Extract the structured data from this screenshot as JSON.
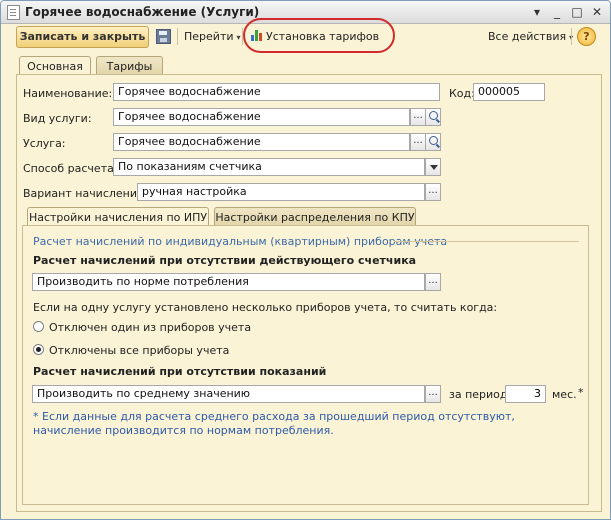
{
  "window": {
    "title": "Горячее водоснабжение (Услуги)",
    "controls": {
      "menu": "▾",
      "minimize": "_",
      "maximize": "□",
      "close": "✕"
    }
  },
  "toolbar": {
    "save_close_label": "Записать и закрыть",
    "goto_label": "Перейти",
    "tariffs_label": "Установка тарифов",
    "all_actions_label": "Все действия",
    "help_label": "?"
  },
  "tabs": [
    {
      "label": "Основная",
      "active": true
    },
    {
      "label": "Тарифы",
      "active": false
    }
  ],
  "form": {
    "name_label": "Наименование:",
    "name_value": "Горячее водоснабжение",
    "code_label": "Код:",
    "code_value": "000005",
    "service_type_label": "Вид услуги:",
    "service_type_value": "Горячее водоснабжение",
    "service_label": "Услуга:",
    "service_value": "Горячее водоснабжение",
    "calc_method_label": "Способ расчета:",
    "calc_method_value": "По показаниям счетчика",
    "accrual_variant_label": "Вариант начисления:",
    "accrual_variant_value": "ручная настройка"
  },
  "subtabs": [
    {
      "label": "Настройки начисления по ИПУ",
      "active": true
    },
    {
      "label": "Настройки распределения по КПУ",
      "active": false
    }
  ],
  "ipu": {
    "group_title": "Расчет начислений по индивидуальным (квартирным) приборам учета",
    "no_meter_title": "Расчет начислений при отсутствии действующего счетчика",
    "no_meter_value": "Производить по норме потребления",
    "multi_meter_question": "Если на одну услугу установлено несколько приборов учета, то считать когда:",
    "radio_options": [
      {
        "label": "Отключен один из приборов учета",
        "checked": false
      },
      {
        "label": "Отключены все приборы учета",
        "checked": true
      }
    ],
    "no_readings_title": "Расчет начислений при отсутствии показаний",
    "no_readings_value": "Производить по среднему значению",
    "period_label": "за период:",
    "period_value": "3",
    "period_unit": "мес.",
    "required_mark": "*",
    "note_line1": "* Если данные для расчета среднего расхода за прошедший период отсутствуют,",
    "note_line2": "начисление производится по нормам потребления."
  },
  "icons": {
    "ellipsis": "...",
    "dropdown_arrow": "▾"
  }
}
